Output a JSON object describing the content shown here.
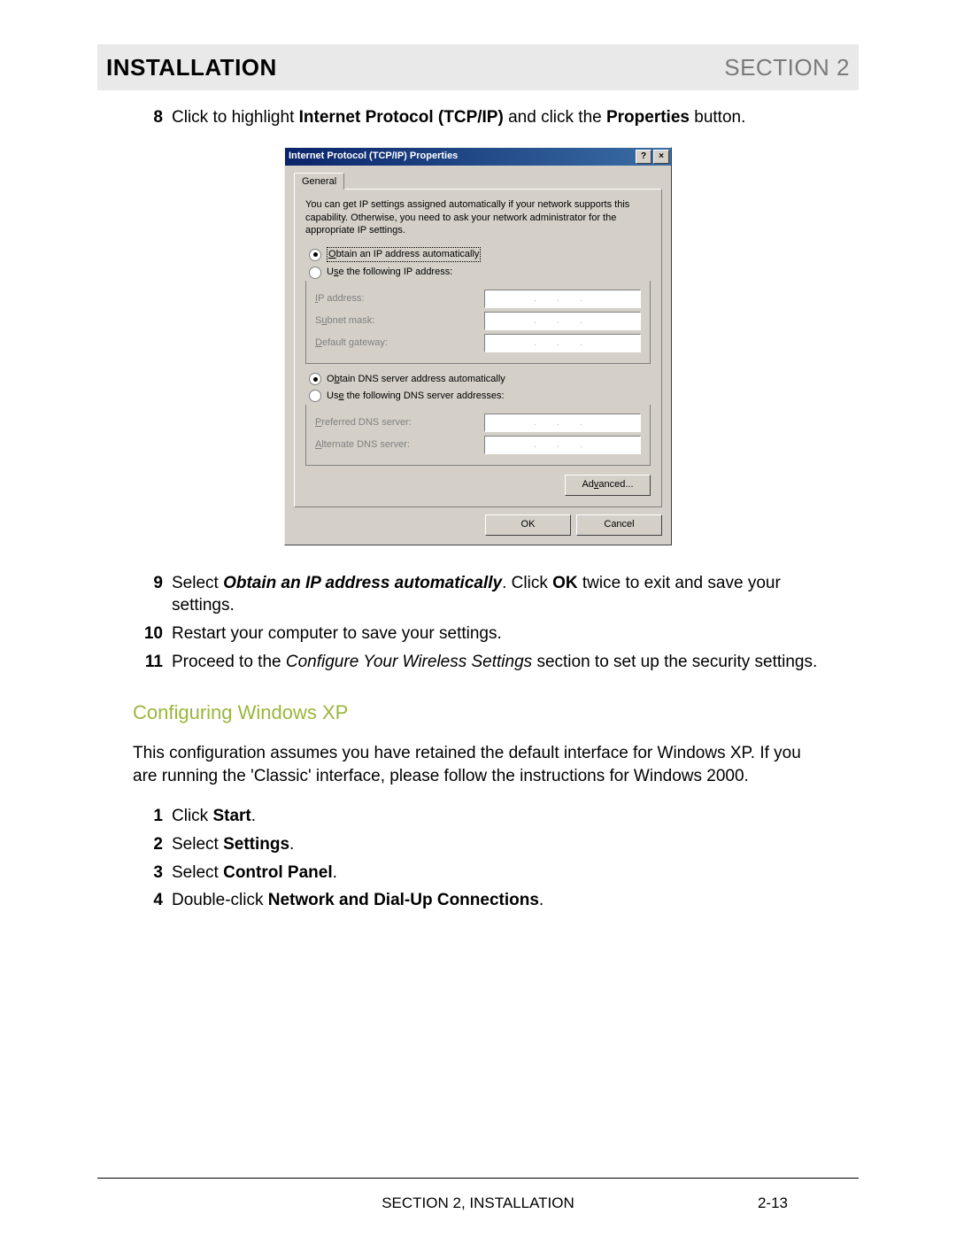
{
  "header": {
    "left": "INSTALLATION",
    "right": "SECTION 2"
  },
  "steps_top": [
    {
      "num": "8",
      "html": "Click to highlight <b>Internet Protocol (TCP/IP)</b> and click the <b>Properties</b> button."
    }
  ],
  "dialog": {
    "title": "Internet Protocol (TCP/IP) Properties",
    "help": "?",
    "close": "×",
    "tab": "General",
    "intro": "You can get IP settings assigned automatically if your network supports this capability. Otherwise, you need to ask your network administrator for the appropriate IP settings.",
    "ip_group": {
      "auto": "Obtain an IP address automatically",
      "manual": "Use the following IP address:",
      "fields": {
        "ip": "IP address:",
        "subnet": "Subnet mask:",
        "gateway": "Default gateway:"
      }
    },
    "dns_group": {
      "auto": "Obtain DNS server address automatically",
      "manual": "Use the following DNS server addresses:",
      "fields": {
        "preferred": "Preferred DNS server:",
        "alternate": "Alternate DNS server:"
      }
    },
    "dots": ". . .",
    "advanced": "Advanced...",
    "ok": "OK",
    "cancel": "Cancel"
  },
  "steps_bottom": [
    {
      "num": "9",
      "html": "Select <b><i>Obtain an IP address automatically</i></b>. Click <b>OK</b> twice to exit and save your settings."
    },
    {
      "num": "10",
      "html": "Restart your computer to save your settings."
    },
    {
      "num": "11",
      "html": "Proceed to the <i>Configure Your Wireless Settings</i> section to set up the security settings."
    }
  ],
  "subheading": "Configuring Windows XP",
  "paragraph": "This configuration assumes you have retained the default interface for Windows XP. If you are running the 'Classic' interface, please follow the instructions for Windows 2000.",
  "steps_xp": [
    {
      "num": "1",
      "html": "Click <b>Start</b>."
    },
    {
      "num": "2",
      "html": "Select <b>Settings</b>."
    },
    {
      "num": "3",
      "html": "Select <b>Control Panel</b>."
    },
    {
      "num": "4",
      "html": "Double-click <b>Network and Dial-Up Connections</b>."
    }
  ],
  "footer": {
    "center": "SECTION 2, INSTALLATION",
    "right": "2-13"
  }
}
